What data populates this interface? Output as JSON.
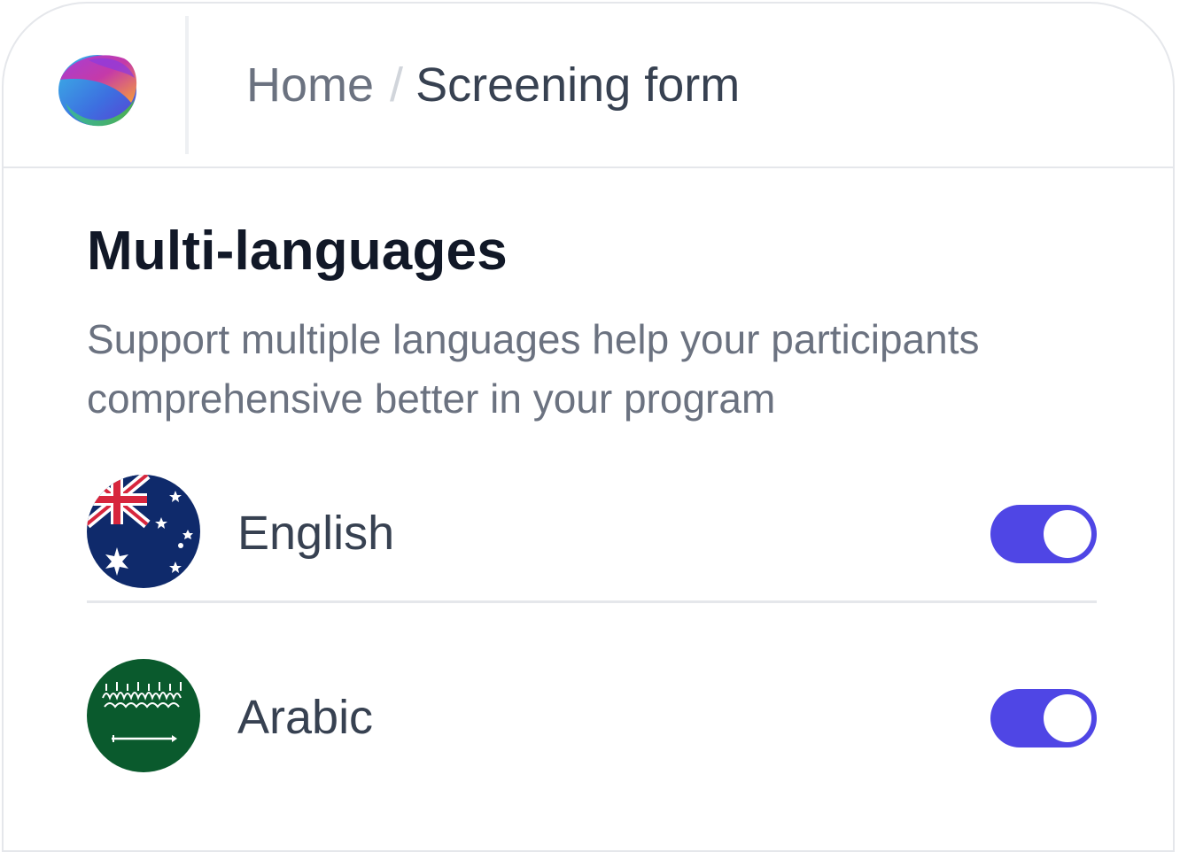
{
  "header": {
    "logo": "app-logo",
    "breadcrumb": {
      "home": "Home",
      "separator": "/",
      "current": "Screening form"
    }
  },
  "section": {
    "title": "Multi-languages",
    "description": "Support multiple languages help your participants comprehensive better in your program"
  },
  "languages": [
    {
      "label": "English",
      "flag": "australia-flag-icon",
      "enabled": true
    },
    {
      "label": "Arabic",
      "flag": "saudi-arabia-flag-icon",
      "enabled": true
    }
  ],
  "colors": {
    "toggle_on": "#4f46e5",
    "title": "#111827",
    "muted": "#6b7280"
  }
}
